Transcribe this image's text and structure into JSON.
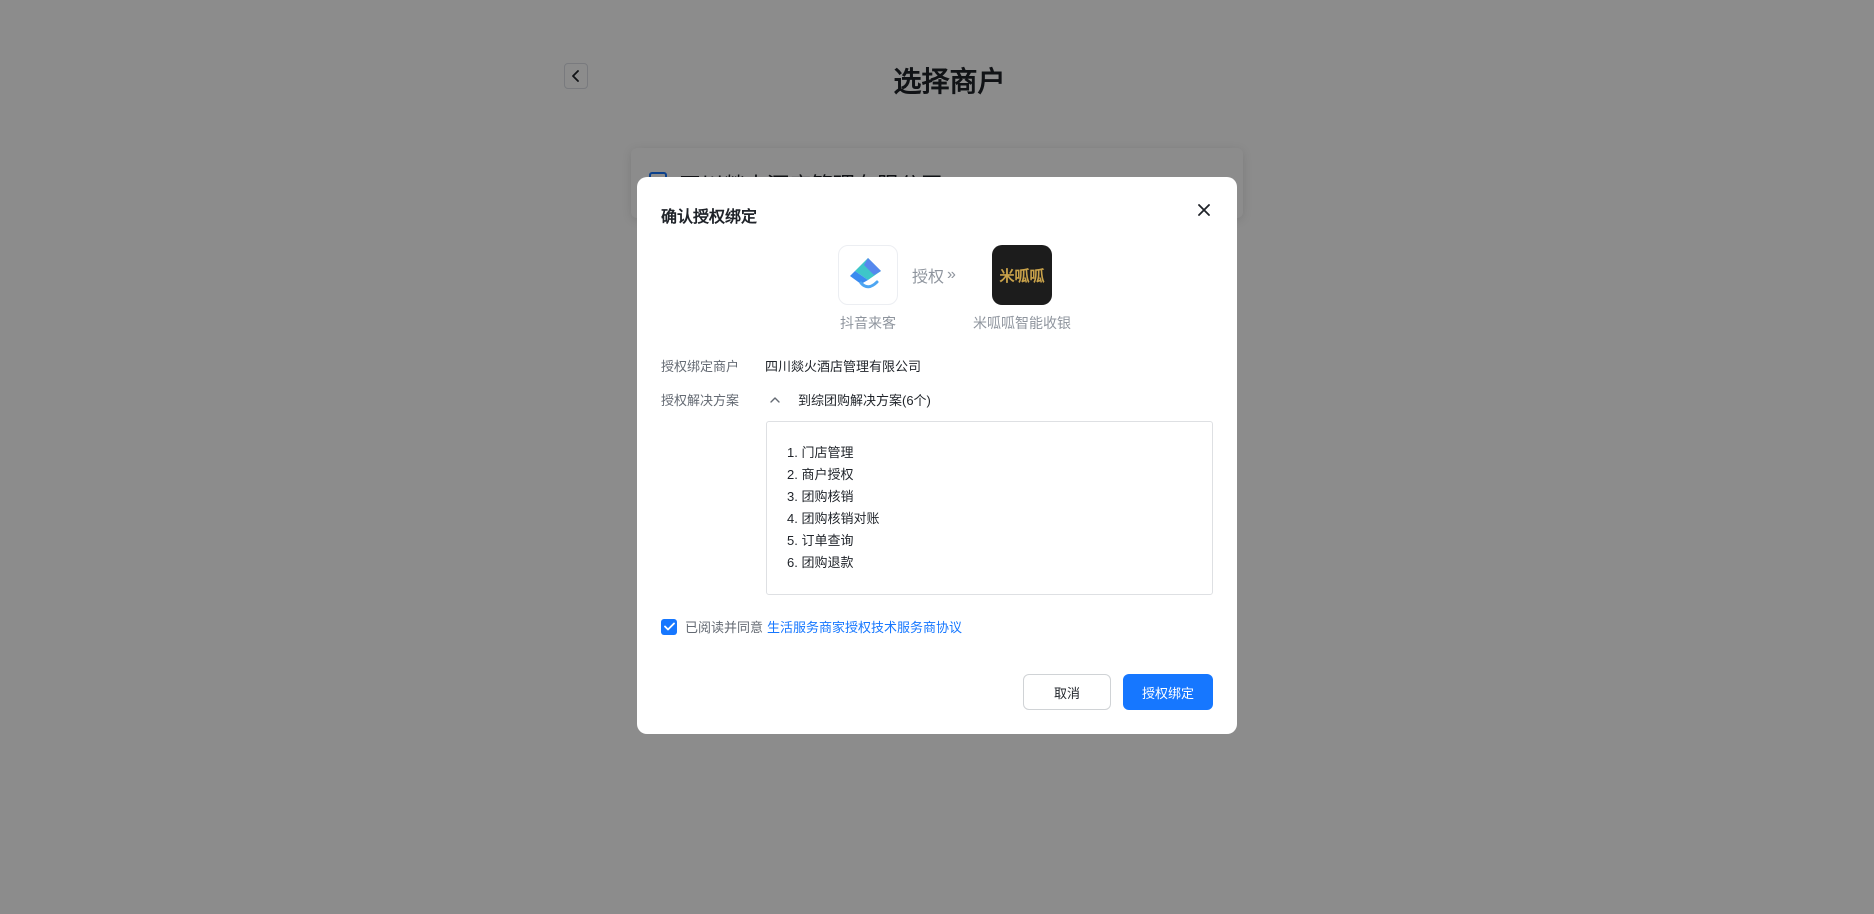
{
  "page": {
    "title": "选择商户",
    "merchant_name": "四川燚火酒店管理有限公司"
  },
  "modal": {
    "title": "确认授权绑定",
    "source_app": {
      "name": "抖音来客",
      "icon": "douyin-laike-logo-icon"
    },
    "auth_label": "授权",
    "auth_arrow": "»",
    "target_app": {
      "name": "米呱呱智能收银",
      "icon": "miguagua-logo-icon",
      "logo_text": "米呱呱"
    },
    "merchant_label": "授权绑定商户",
    "merchant_value": "四川燚火酒店管理有限公司",
    "solution_label": "授权解决方案",
    "solution_value": "到综团购解决方案(6个)",
    "features": [
      "1. 门店管理",
      "2. 商户授权",
      "3. 团购核销",
      "4. 团购核销对账",
      "5. 订单查询",
      "6. 团购退款"
    ],
    "agree_text": "已阅读并同意",
    "agree_link": "生活服务商家授权技术服务商协议",
    "agree_checked": true,
    "cancel_label": "取消",
    "confirm_label": "授权绑定"
  },
  "colors": {
    "primary": "#1677ff",
    "overlay": "rgba(0,0,0,0.45)",
    "muted_text": "#8f959e"
  }
}
